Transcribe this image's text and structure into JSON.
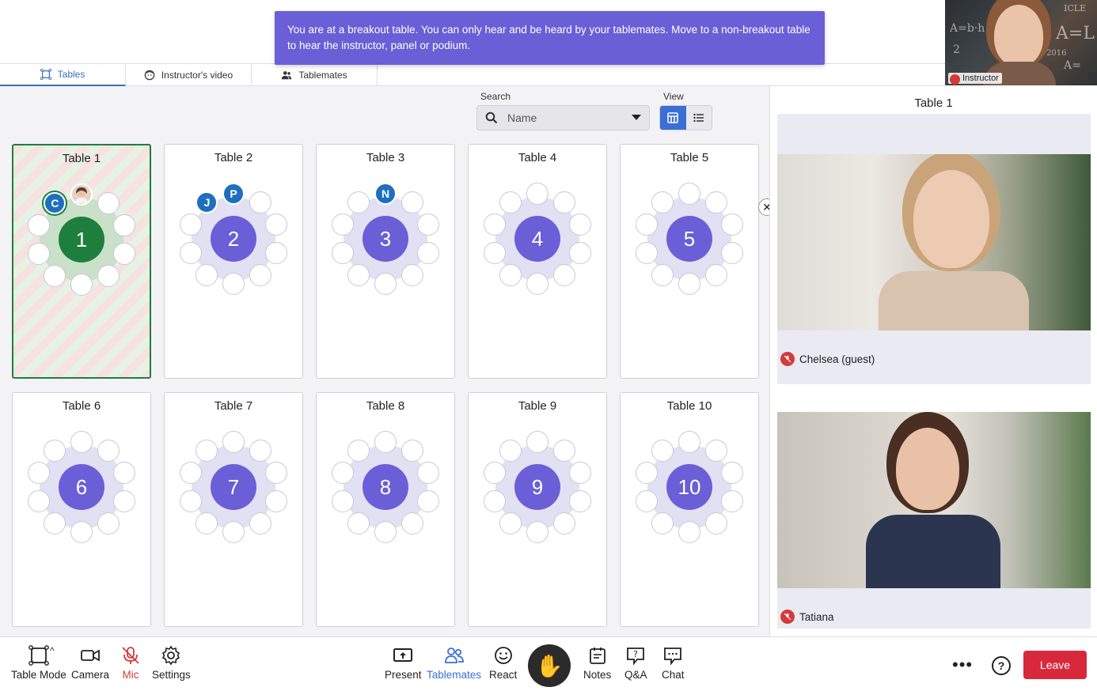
{
  "banner": {
    "text": "You are at a breakout table. You can only hear and be heard by your tablemates. Move to a non-breakout table to hear the instructor, panel or podium."
  },
  "instructor_thumb": {
    "label": "Instructor",
    "chalk": [
      "A=b·h",
      "A=L×",
      "2",
      "A=",
      "ICLE",
      "2016"
    ]
  },
  "tabs": [
    {
      "label": "Tables",
      "icon": "tables-icon",
      "active": true
    },
    {
      "label": "Instructor's video",
      "icon": "face-icon",
      "active": false
    },
    {
      "label": "Tablemates",
      "icon": "people-icon",
      "active": false
    }
  ],
  "search": {
    "label": "Search",
    "placeholder": "Name"
  },
  "view": {
    "label": "View",
    "active": "grid"
  },
  "tables": [
    {
      "title": "Table 1",
      "number": "1",
      "active": true,
      "avatars": [
        {
          "initial": "C",
          "seat": 9,
          "style": "green"
        },
        {
          "initial": "",
          "seat": 0,
          "style": "photo"
        }
      ]
    },
    {
      "title": "Table 2",
      "number": "2",
      "active": false,
      "avatars": [
        {
          "initial": "J",
          "seat": 9
        },
        {
          "initial": "P",
          "seat": 0
        }
      ]
    },
    {
      "title": "Table 3",
      "number": "3",
      "active": false,
      "avatars": [
        {
          "initial": "N",
          "seat": 0
        }
      ]
    },
    {
      "title": "Table 4",
      "number": "4",
      "active": false,
      "avatars": []
    },
    {
      "title": "Table 5",
      "number": "5",
      "active": false,
      "avatars": []
    },
    {
      "title": "Table 6",
      "number": "6",
      "active": false,
      "avatars": []
    },
    {
      "title": "Table 7",
      "number": "7",
      "active": false,
      "avatars": []
    },
    {
      "title": "Table 8",
      "number": "8",
      "active": false,
      "avatars": []
    },
    {
      "title": "Table 9",
      "number": "9",
      "active": false,
      "avatars": []
    },
    {
      "title": "Table 10",
      "number": "10",
      "active": false,
      "avatars": []
    }
  ],
  "right_panel": {
    "title": "Table 1",
    "participants": [
      {
        "name": "Chelsea (guest)",
        "mic": "muted"
      },
      {
        "name": "Tatiana",
        "mic": "muted"
      }
    ]
  },
  "bottombar": {
    "left": [
      {
        "label": "Table Mode",
        "icon": "table-mode-icon"
      },
      {
        "label": "Camera",
        "icon": "camera-icon"
      },
      {
        "label": "Mic",
        "icon": "mic-off-icon",
        "state": "muted"
      },
      {
        "label": "Settings",
        "icon": "gear-icon"
      }
    ],
    "center": [
      {
        "label": "Present",
        "icon": "present-icon"
      },
      {
        "label": "Tablemates",
        "icon": "tablemates-icon",
        "state": "active"
      },
      {
        "label": "React",
        "icon": "smile-icon"
      },
      {
        "label": "Notes",
        "icon": "notes-icon"
      },
      {
        "label": "Q&A",
        "icon": "qa-icon"
      },
      {
        "label": "Chat",
        "icon": "chat-icon"
      }
    ],
    "more": "•••",
    "help": "?",
    "leave": "Leave"
  },
  "colors": {
    "brand": "#6a5fd6",
    "active_table": "#1e7f3c",
    "accent": "#3b6fd6",
    "leave": "#d8283b",
    "muted": "#d43a3a"
  }
}
